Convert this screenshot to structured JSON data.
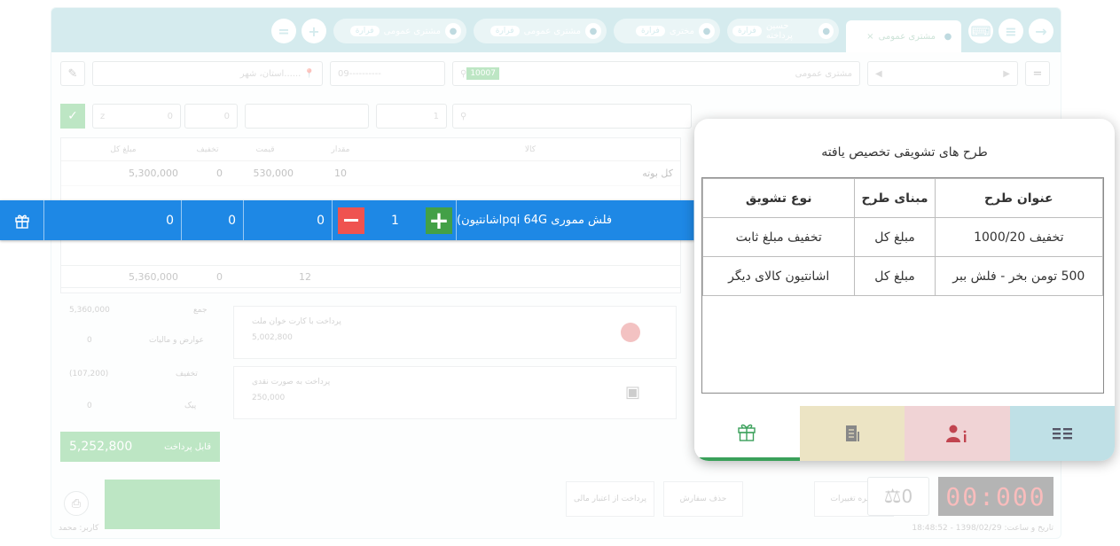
{
  "background_app": {
    "tabs": [
      {
        "label": "مشتری عمومی",
        "close": "×"
      },
      {
        "label": "حسین پرداخته",
        "badge": "فرارة"
      },
      {
        "label": "مختری",
        "badge": "فرارة"
      },
      {
        "label": "مشتری عمومی",
        "badge": "فرارة"
      },
      {
        "label": "مشتری عمومی",
        "badge": "فرارة"
      }
    ],
    "customer_field": "مشتری عمومی",
    "barcode_badge": "10007",
    "phone_placeholder": "09----------",
    "city_placeholder": "استان، شهر......",
    "qty_field": "1",
    "zero_a": "0",
    "zero_b": "0",
    "z_label": "z",
    "columns": [
      "مبلغ کل",
      "تخفیف",
      "قیمت",
      "مقدار",
      "کالا"
    ],
    "row1": {
      "total": "5,300,000",
      "discount": "0",
      "price": "530,000",
      "qty": "10",
      "name": "کل بوته"
    },
    "footer_row": {
      "total": "5,360,000",
      "discount": "0",
      "qty": "12"
    },
    "sum_label": "جمع",
    "sum_value": "5,360,000",
    "tax_label": "عوارض و مالیات",
    "tax_value": "0",
    "discount_label": "تخفیف",
    "discount_value": "(107,200)",
    "tip_label": "پیک",
    "tip_value": "0",
    "payable_label": "قابل پرداخت",
    "payable_value": "5,252,800",
    "pay_card_label": "پرداخت با کارت خوان ملت",
    "pay_card_value": "5,002,800",
    "pay_cash_label": "پرداخت به صورت نقدی",
    "pay_cash_value": "250,000",
    "action_save": "ذخیره تغییرات",
    "action_cancel": "حذف سفارش",
    "action_receive": "پرداخت از اعتبار مالی",
    "clock": "00:000",
    "scale_value": "0",
    "status_left": "کاربر: محمد",
    "status_right": "تاریخ و ساعت: 1398/02/29 - 18:48:52"
  },
  "highlight_row": {
    "product": "فلش مموری pqi 64Gاشانتیون)",
    "qty": "1",
    "price": "0",
    "discount": "0",
    "total": "0",
    "minus": "−",
    "plus": "+"
  },
  "popup": {
    "title": "طرح های تشویقی تخصیص یافته",
    "headers": [
      "عنوان طرح",
      "مبنای طرح",
      "نوع تشویق"
    ],
    "rows": [
      [
        "تخفیف 1000/20",
        "مبلغ کل",
        "تخفیف مبلغ ثابت"
      ],
      [
        "500 تومن بخر - فلش ببر",
        "مبلغ کل",
        "اشانتیون کالای دیگر"
      ]
    ],
    "tab_icons": [
      "list-icon",
      "user-info-icon",
      "document-icon",
      "gift-icon"
    ]
  },
  "colors": {
    "row_blue": "#1e88e5",
    "plus_green": "#43a047",
    "minus_red": "#ef5350",
    "topbar_teal": "#7ec4cc",
    "tab_menu": "#bfe0e6",
    "tab_user": "#f0d3d5",
    "tab_doc": "#ece4c4"
  }
}
